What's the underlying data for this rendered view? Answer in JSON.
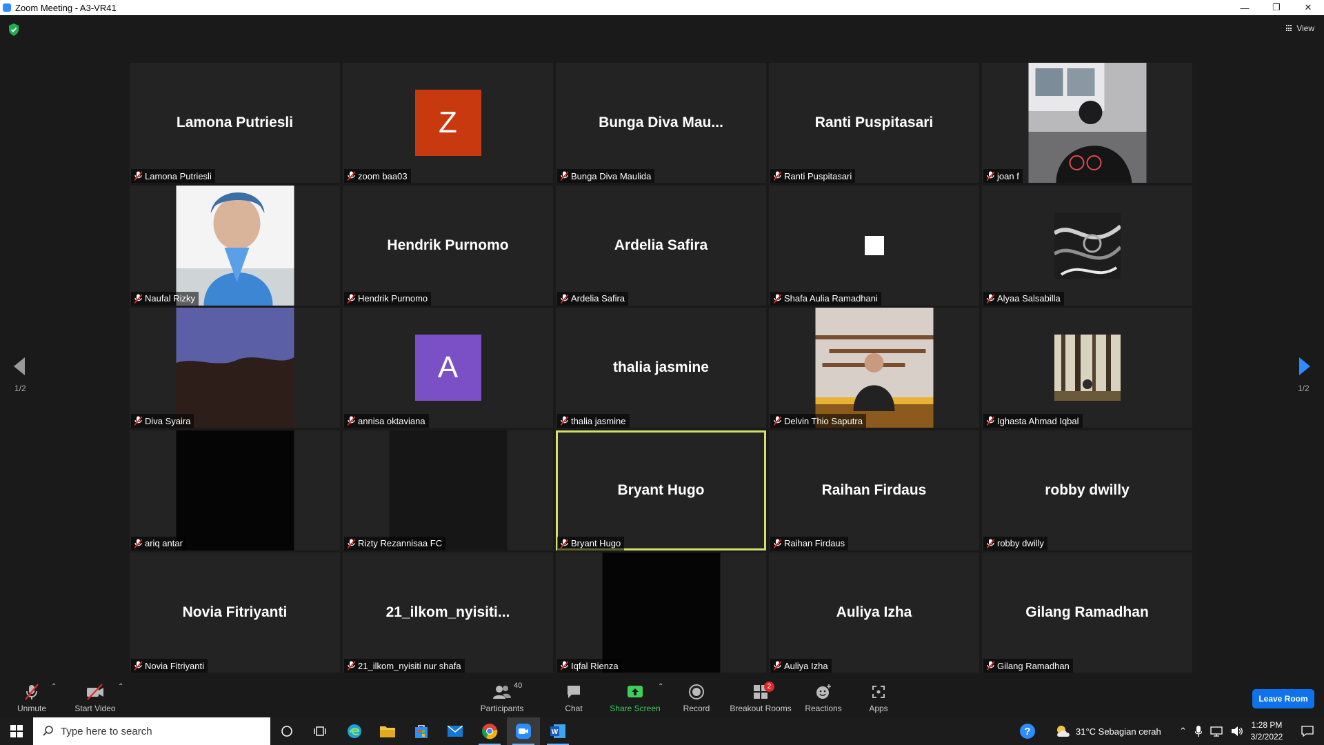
{
  "window": {
    "title": "Zoom Meeting - A3-VR41",
    "view_label": "View"
  },
  "gallery": {
    "page_left": "1/2",
    "page_right": "1/2",
    "tiles": [
      {
        "display": "Lamona Putriesli",
        "name": "Lamona Putriesli",
        "kind": "name"
      },
      {
        "display": "Z",
        "name": "zoom baa03",
        "kind": "avatar",
        "color": "#c9390f"
      },
      {
        "display": "Bunga  Diva  Mau...",
        "name": "Bunga Diva Maulida",
        "kind": "name"
      },
      {
        "display": "Ranti Puspitasari",
        "name": "Ranti Puspitasari",
        "kind": "name"
      },
      {
        "display": "",
        "name": "joan f",
        "kind": "photo-joan"
      },
      {
        "display": "",
        "name": "Naufal Rizky",
        "kind": "photo-naufal"
      },
      {
        "display": "Hendrik Purnomo",
        "name": "Hendrik Purnomo",
        "kind": "name"
      },
      {
        "display": "Ardelia Safira",
        "name": "Ardelia Safira",
        "kind": "name"
      },
      {
        "display": "",
        "name": "Shafa  Aulia Ramadhani",
        "kind": "square"
      },
      {
        "display": "",
        "name": "Alyaa Salsabilla",
        "kind": "photo-alyaa"
      },
      {
        "display": "",
        "name": "Diva Syaira",
        "kind": "photo-diva"
      },
      {
        "display": "A",
        "name": "annisa oktaviana",
        "kind": "avatar",
        "color": "#7b4fc6"
      },
      {
        "display": "thalia jasmine",
        "name": "thalia jasmine",
        "kind": "name"
      },
      {
        "display": "",
        "name": "Delvin Thio Saputra",
        "kind": "photo-delvin"
      },
      {
        "display": "",
        "name": "Ighasta Ahmad Iqbal",
        "kind": "photo-ighasta"
      },
      {
        "display": "",
        "name": "ariq antar",
        "kind": "photo-black"
      },
      {
        "display": "",
        "name": "Rizty Rezannisaa FC",
        "kind": "photo-dark"
      },
      {
        "display": "Bryant Hugo",
        "name": "Bryant Hugo",
        "kind": "name",
        "active": true
      },
      {
        "display": "Raihan Firdaus",
        "name": "Raihan Firdaus",
        "kind": "name"
      },
      {
        "display": "robby dwilly",
        "name": "robby dwilly",
        "kind": "name"
      },
      {
        "display": "Novia Fitriyanti",
        "name": "Novia Fitriyanti",
        "kind": "name"
      },
      {
        "display": "21_ilkom_nyisiti...",
        "name": "21_ilkom_nyisiti nur shafa",
        "kind": "name"
      },
      {
        "display": "",
        "name": "Iqfal Rienza",
        "kind": "photo-black"
      },
      {
        "display": "Auliya Izha",
        "name": "Auliya Izha",
        "kind": "name"
      },
      {
        "display": "Gilang Ramadhan",
        "name": "Gilang Ramadhan",
        "kind": "name"
      }
    ]
  },
  "toolbar": {
    "unmute": "Unmute",
    "start_video": "Start Video",
    "participants": "Participants",
    "participant_count": "40",
    "chat": "Chat",
    "share_screen": "Share Screen",
    "record": "Record",
    "breakout_rooms": "Breakout Rooms",
    "breakout_badge": "2",
    "reactions": "Reactions",
    "apps": "Apps",
    "leave_room": "Leave Room"
  },
  "taskbar": {
    "search_placeholder": "Type here to search",
    "weather": "31°C  Sebagian cerah",
    "time": "1:28 PM",
    "date": "3/2/2022"
  },
  "colors": {
    "share_green": "#3ecf5a",
    "leave_blue": "#0e72ed",
    "active_border": "#d4e06a"
  }
}
